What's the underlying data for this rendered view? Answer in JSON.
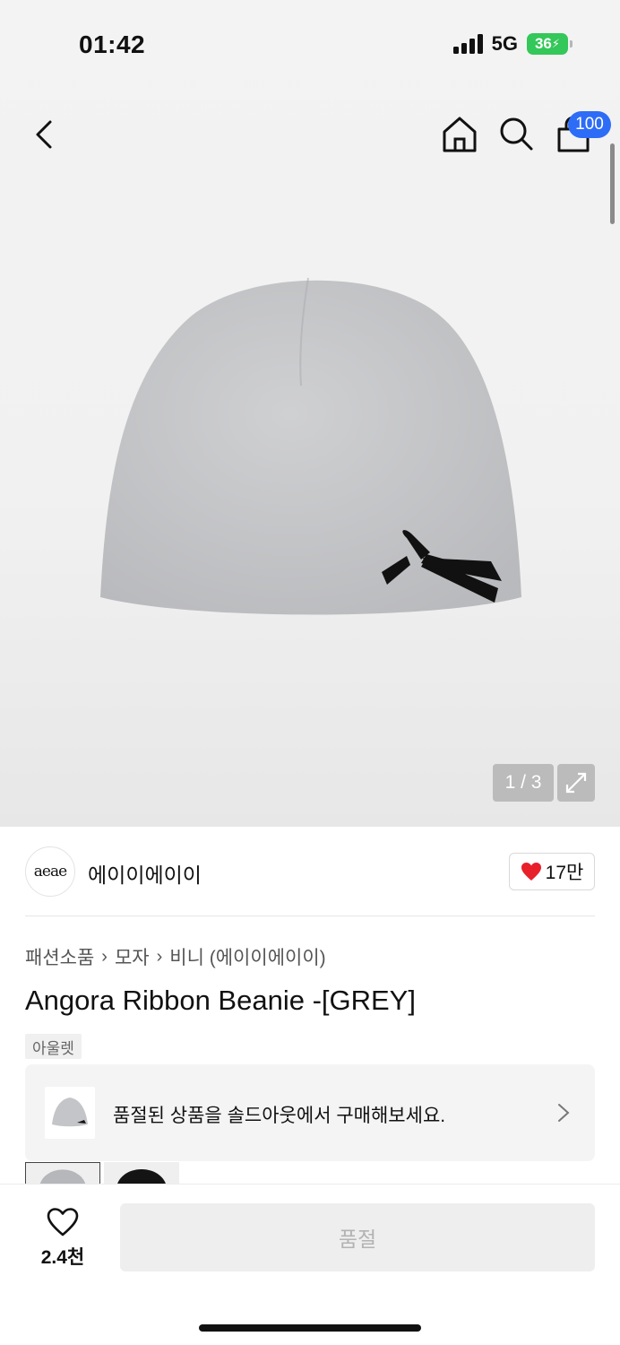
{
  "status_bar": {
    "time": "01:42",
    "network": "5G",
    "battery": "36"
  },
  "header": {
    "cart_badge": "100"
  },
  "gallery": {
    "counter": "1 / 3"
  },
  "brand": {
    "logo_text": "aeae",
    "name": "에이이에이이",
    "likes": "17만"
  },
  "breadcrumb": {
    "items": [
      "패션소품",
      "모자",
      "비니 (에이이에이이)"
    ]
  },
  "product": {
    "title": "Angora Ribbon Beanie -[GREY]",
    "tag": "아울렛"
  },
  "soldout_banner": {
    "text": "품절된 상품을 솔드아웃에서 구매해보세요."
  },
  "bottom": {
    "wish_count": "2.4천",
    "buy_label": "품절"
  },
  "colors": {
    "badge": "#2d6cf6",
    "heart": "#e8202a",
    "battery": "#34c759"
  },
  "icons": [
    "back-icon",
    "home-icon",
    "search-icon",
    "bag-icon",
    "expand-icon",
    "heart-icon",
    "chevron-right-icon"
  ]
}
